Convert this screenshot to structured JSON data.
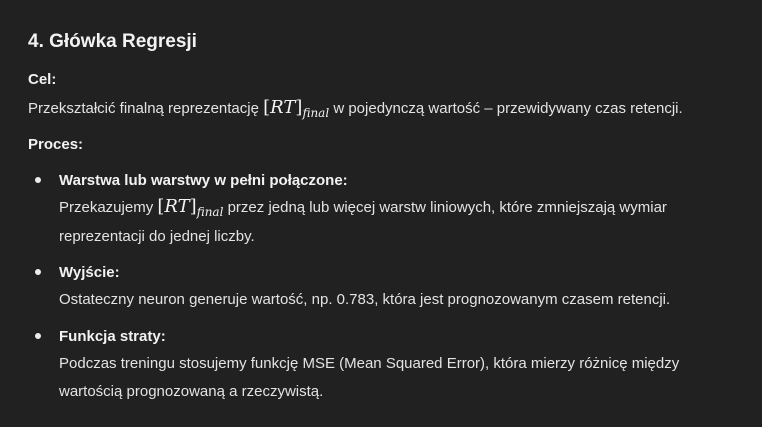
{
  "section": {
    "heading": "4. Główka Regresji",
    "goal_label": "Cel:",
    "goal_text_before": "Przekształcić finalną reprezentację",
    "goal_math_base": "RT",
    "goal_math_sub": "final",
    "goal_text_after": "w pojedynczą wartość – przewidywany czas retencji.",
    "process_label": "Proces:",
    "items": [
      {
        "title": "Warstwa lub warstwy w pełni połączone:",
        "line1_before": "Przekazujemy",
        "math_base": "RT",
        "math_sub": "final",
        "line1_after": "przez jedną lub więcej warstw liniowych, które zmniejszają wymiar",
        "line2": "reprezentacji do jednej liczby."
      },
      {
        "title": "Wyjście:",
        "line1": "Ostateczny neuron generuje wartość, np. 0.783, która jest prognozowanym czasem retencji."
      },
      {
        "title": "Funkcja straty:",
        "line1": "Podczas treningu stosujemy funkcję MSE (Mean Squared Error), która mierzy różnicę między",
        "line2": "wartością prognozowaną a rzeczywistą."
      }
    ]
  }
}
